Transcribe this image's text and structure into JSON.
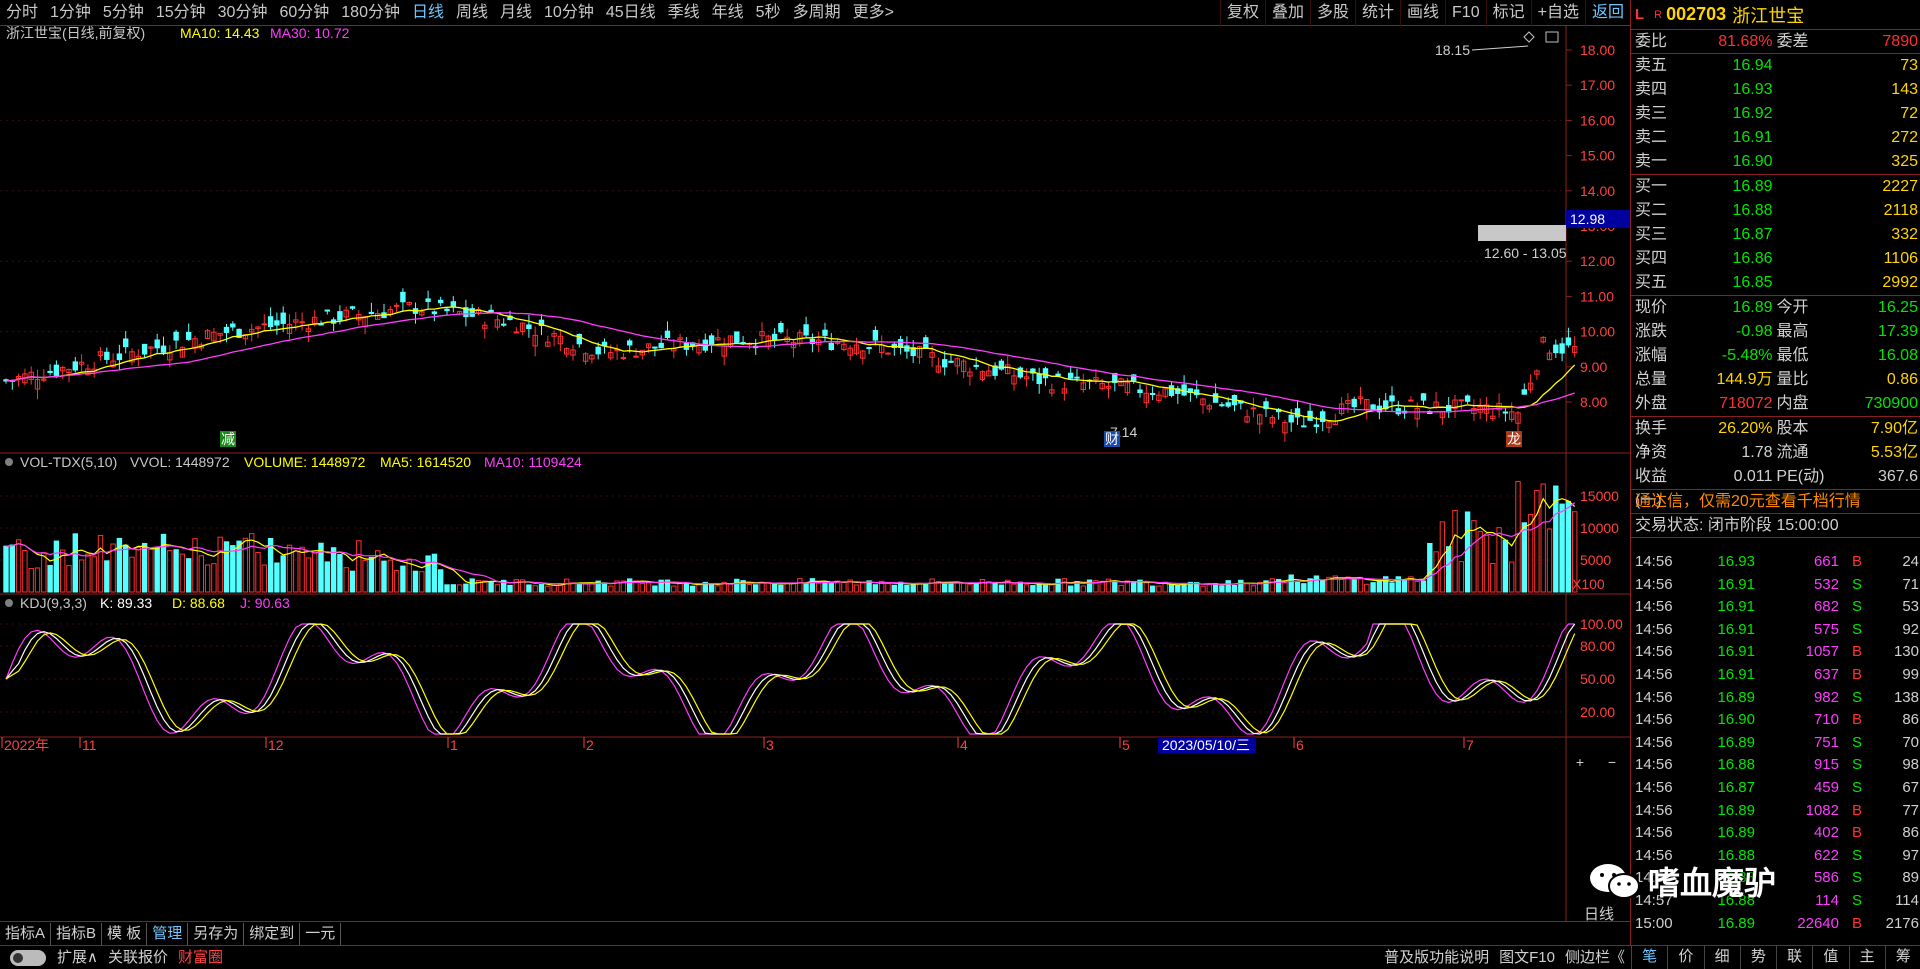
{
  "toolbar": {
    "left": [
      "分时",
      "1分钟",
      "5分钟",
      "15分钟",
      "30分钟",
      "60分钟",
      "180分钟",
      "日线",
      "周线",
      "月线",
      "10分钟",
      "45日线",
      "季线",
      "年线",
      "5秒",
      "多周期",
      "更多>"
    ],
    "active": "日线",
    "right": [
      "复权",
      "叠加",
      "多股",
      "统计",
      "画线",
      "F10",
      "标记",
      "+自选",
      "返回"
    ]
  },
  "main_chart": {
    "title": "浙江世宝(日线,前复权)",
    "ma10_label": "MA10: 14.43",
    "ma30_label": "MA30: 10.72",
    "yticks": [
      "18.00",
      "17.00",
      "16.00",
      "15.00",
      "14.00",
      "13.00",
      "12.00",
      "11.00",
      "10.00",
      "9.00",
      "8.00"
    ],
    "current_price_tag": "12.98",
    "high_annotation": "18.15",
    "low_annotation": "7.14",
    "range_annotation": "12.60 - 13.05",
    "markers": [
      "减",
      "财",
      "龙"
    ]
  },
  "volume_panel": {
    "title": "VOL-TDX(5,10)",
    "vvol": "VVOL: 1448972",
    "volume": "VOLUME: 1448972",
    "ma5": "MA5: 1614520",
    "ma10": "MA10: 1109424",
    "yticks": [
      "15000",
      "10000",
      "5000"
    ],
    "unit": "X100"
  },
  "kdj_panel": {
    "title": "KDJ(9,3,3)",
    "k": "K: 89.33",
    "d": "D: 88.68",
    "j": "J: 90.63",
    "yticks": [
      "100.00",
      "80.00",
      "50.00",
      "20.00"
    ]
  },
  "xaxis": {
    "labels": [
      "2022年",
      "11",
      "12",
      "1",
      "2",
      "3",
      "4",
      "5",
      "6",
      "7"
    ],
    "cursor_date": "2023/05/10/三",
    "period": "日线",
    "zoom": [
      "+",
      "−"
    ]
  },
  "bottom_tabs": [
    "指标A",
    "指标B",
    "模 板",
    "管理",
    "另存为",
    "绑定到",
    "一元"
  ],
  "bottom_active": "管理",
  "statusbar": {
    "left": [
      "扩展∧",
      "关联报价",
      "财富圈"
    ],
    "right": [
      "普及版功能说明",
      "图文F10",
      "侧边栏《"
    ]
  },
  "quote": {
    "flag": "L",
    "r": "R",
    "code": "002703",
    "name": "浙江世宝",
    "weibi_label": "委比",
    "weibi": "81.68%",
    "weicha_label": "委差",
    "weicha": "7890",
    "asks": [
      {
        "label": "卖五",
        "price": "16.94",
        "vol": "73"
      },
      {
        "label": "卖四",
        "price": "16.93",
        "vol": "143"
      },
      {
        "label": "卖三",
        "price": "16.92",
        "vol": "72"
      },
      {
        "label": "卖二",
        "price": "16.91",
        "vol": "272"
      },
      {
        "label": "卖一",
        "price": "16.90",
        "vol": "325"
      }
    ],
    "bids": [
      {
        "label": "买一",
        "price": "16.89",
        "vol": "2227"
      },
      {
        "label": "买二",
        "price": "16.88",
        "vol": "2118"
      },
      {
        "label": "买三",
        "price": "16.87",
        "vol": "332"
      },
      {
        "label": "买四",
        "price": "16.86",
        "vol": "1106"
      },
      {
        "label": "买五",
        "price": "16.85",
        "vol": "2992"
      }
    ],
    "stats1": [
      {
        "a": "现价",
        "b": "16.89",
        "c": "今开",
        "d": "16.25"
      },
      {
        "a": "涨跌",
        "b": "-0.98",
        "c": "最高",
        "d": "17.39"
      },
      {
        "a": "涨幅",
        "b": "-5.48%",
        "c": "最低",
        "d": "16.08"
      },
      {
        "a": "总量",
        "b": "144.9万",
        "c": "量比",
        "d": "0.86"
      },
      {
        "a": "外盘",
        "b": "718072",
        "c": "内盘",
        "d": "730900"
      }
    ],
    "stats2": [
      {
        "a": "换手",
        "b": "26.20%",
        "c": "股本",
        "d": "7.90亿"
      },
      {
        "a": "净资",
        "b": "1.78",
        "c": "流通",
        "d": "5.53亿"
      },
      {
        "a": "收益(一)",
        "b": "0.011",
        "c": "PE(动)",
        "d": "367.6"
      }
    ],
    "promo": "通达信，仅需20元查看千档行情",
    "trade_state": "交易状态: 闭市阶段 15:00:00",
    "ticks": [
      {
        "t": "14:56",
        "p": "16.93",
        "v": "661",
        "bs": "B",
        "n": "24"
      },
      {
        "t": "14:56",
        "p": "16.91",
        "v": "532",
        "bs": "S",
        "n": "71"
      },
      {
        "t": "14:56",
        "p": "16.91",
        "v": "682",
        "bs": "S",
        "n": "53"
      },
      {
        "t": "14:56",
        "p": "16.91",
        "v": "575",
        "bs": "S",
        "n": "92"
      },
      {
        "t": "14:56",
        "p": "16.91",
        "v": "1057",
        "bs": "B",
        "n": "130"
      },
      {
        "t": "14:56",
        "p": "16.91",
        "v": "637",
        "bs": "B",
        "n": "99"
      },
      {
        "t": "14:56",
        "p": "16.89",
        "v": "982",
        "bs": "S",
        "n": "138"
      },
      {
        "t": "14:56",
        "p": "16.90",
        "v": "710",
        "bs": "B",
        "n": "86"
      },
      {
        "t": "14:56",
        "p": "16.89",
        "v": "751",
        "bs": "S",
        "n": "70"
      },
      {
        "t": "14:56",
        "p": "16.88",
        "v": "915",
        "bs": "S",
        "n": "98"
      },
      {
        "t": "14:56",
        "p": "16.87",
        "v": "459",
        "bs": "S",
        "n": "67"
      },
      {
        "t": "14:56",
        "p": "16.89",
        "v": "1082",
        "bs": "B",
        "n": "77"
      },
      {
        "t": "14:56",
        "p": "16.89",
        "v": "402",
        "bs": "B",
        "n": "86"
      },
      {
        "t": "14:56",
        "p": "16.88",
        "v": "622",
        "bs": "S",
        "n": "97"
      },
      {
        "t": "14:56",
        "p": "16.88",
        "v": "586",
        "bs": "S",
        "n": "89"
      },
      {
        "t": "14:57",
        "p": "16.88",
        "v": "114",
        "bs": "S",
        "n": "114"
      },
      {
        "t": "15:00",
        "p": "16.89",
        "v": "22640",
        "bs": "B",
        "n": "2176"
      }
    ],
    "tabs": [
      "笔",
      "价",
      "细",
      "势",
      "联",
      "值",
      "主",
      "筹"
    ]
  },
  "watermark": "嗜血魔驴",
  "colors": {
    "up": "#ff3030",
    "down": "#54ffff",
    "ma10": "#ffff00",
    "ma30": "#ff3cff",
    "k": "#ffffff",
    "d": "#ffff00",
    "j": "#ff3cff"
  }
}
